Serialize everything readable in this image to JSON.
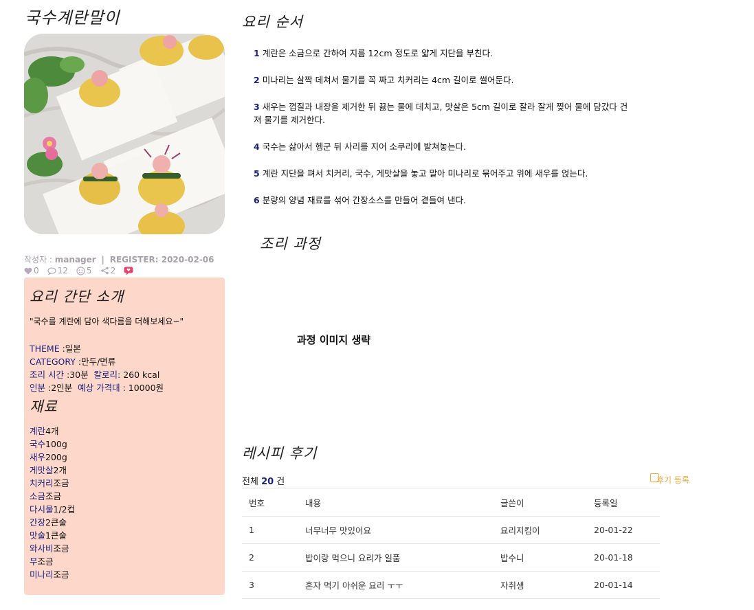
{
  "recipe": {
    "title": "국수계란말이"
  },
  "meta": {
    "author_label": "작성자 : ",
    "author": "manager",
    "register_label": "REGISTER: ",
    "register_date": "2020-02-06"
  },
  "stats": {
    "likes": "0",
    "comments": "12",
    "reactions": "5",
    "shares": "2"
  },
  "intro": {
    "title": "요리 간단 소개",
    "quote": "\"국수를 계란에 담아 색다름을 더해보세요~\"",
    "theme_label": "THEME",
    "theme": " :일본",
    "category_label": "CATEGORY",
    "category": " :만두/면류",
    "time_label": "조리 시간",
    "time": " :30분",
    "calorie_label": "칼로리:",
    "calorie": " 260 kcal",
    "serving_label": "인분",
    "serving": " :2인분",
    "price_label": "예상 가격대",
    "price": " : 10000원"
  },
  "ingredients": {
    "title": "재료",
    "items": [
      {
        "name": "계란",
        "qty": "4개"
      },
      {
        "name": "국수",
        "qty": "100g"
      },
      {
        "name": "새우",
        "qty": "200g"
      },
      {
        "name": "게맛살",
        "qty": "2개"
      },
      {
        "name": "치커리",
        "qty": "조금"
      },
      {
        "name": "소금",
        "qty": "조금"
      },
      {
        "name": "다시물",
        "qty": "1/2컵"
      },
      {
        "name": "간장",
        "qty": "2큰술"
      },
      {
        "name": "맛술",
        "qty": "1큰술"
      },
      {
        "name": "와사비",
        "qty": "조금"
      },
      {
        "name": "무",
        "qty": "조금"
      },
      {
        "name": "미나리",
        "qty": "조금"
      }
    ]
  },
  "steps": {
    "title": "요리 순서",
    "items": [
      {
        "num": "1",
        "text": "계란은 소금으로 간하여 지름 12cm 정도로 얇게 지단을 부친다."
      },
      {
        "num": "2",
        "text": "미나리는 살짝 데쳐서 물기를 꼭 짜고 치커리는 4cm 길이로 썰어둔다."
      },
      {
        "num": "3",
        "text": "새우는 껍질과 내장을 제거한 뒤 끓는 물에 데치고, 맛살은 5cm 길이로 잘라 잘게 찢어 물에 담갔다 건져 물기를 제거한다."
      },
      {
        "num": "4",
        "text": "국수는 삶아서 헹군 뒤 사리를 지어 소쿠리에 밭쳐놓는다."
      },
      {
        "num": "5",
        "text": "계란 지단을 펴서 치커리, 국수, 게맛살을 놓고 말아 미나리로 묶어주고 위에 새우를 얹는다."
      },
      {
        "num": "6",
        "text": "분량의 양념 재료를 섞어 간장소스를 만들어 곁들여 낸다."
      }
    ]
  },
  "process": {
    "title": "조리 과정",
    "note": "과정 이미지 생략"
  },
  "reviews": {
    "title": "레시피 후기",
    "total_prefix": "전체 ",
    "total": "20",
    "total_suffix": " 건",
    "write_label": "후기 등록",
    "columns": [
      "번호",
      "내용",
      "글쓴이",
      "등록일"
    ],
    "rows": [
      {
        "no": "1",
        "content": "너무너무 맛있어요",
        "writer": "요리지킴이",
        "date": "20-01-22"
      },
      {
        "no": "2",
        "content": "밥이랑 먹으니 요리가 일품",
        "writer": "밥수니",
        "date": "20-01-18"
      },
      {
        "no": "3",
        "content": "혼자 먹기 아쉬운 요리 ㅜㅜ",
        "writer": "자취생",
        "date": "20-01-14"
      }
    ]
  },
  "colors": {
    "intro_bg": "#fdd7ca",
    "label": "#1a237e",
    "accent": "#f3a93d",
    "meta": "#a6a1a8"
  },
  "icons": [
    "heart-icon",
    "comment-icon",
    "smile-icon",
    "share-icon",
    "chat-bubble-icon",
    "write-icon"
  ]
}
